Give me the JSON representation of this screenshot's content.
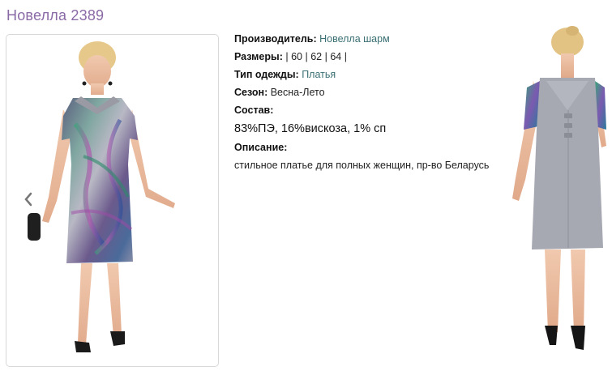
{
  "product": {
    "title": "Новелла 2389"
  },
  "details": {
    "manufacturer_label": "Производитель:",
    "manufacturer_value": "Новелла шарм",
    "sizes_label": "Размеры:",
    "sizes": [
      "60",
      "62",
      "64"
    ],
    "type_label": "Тип одежды:",
    "type_value": "Платья",
    "season_label": "Сезон:",
    "season_value": "Весна-Лето",
    "composition_label": "Состав:",
    "composition_value": "83%ПЭ, 16%вискоза, 1% сп",
    "description_label": "Описание:",
    "description_value": "стильное платье для полных женщин, пр-во Беларусь"
  },
  "gallery": {
    "prev_icon": "chevron-left-icon"
  },
  "colors": {
    "title": "#8a6aa6",
    "link": "#3a6f73",
    "card_border": "#d8d8d8"
  }
}
